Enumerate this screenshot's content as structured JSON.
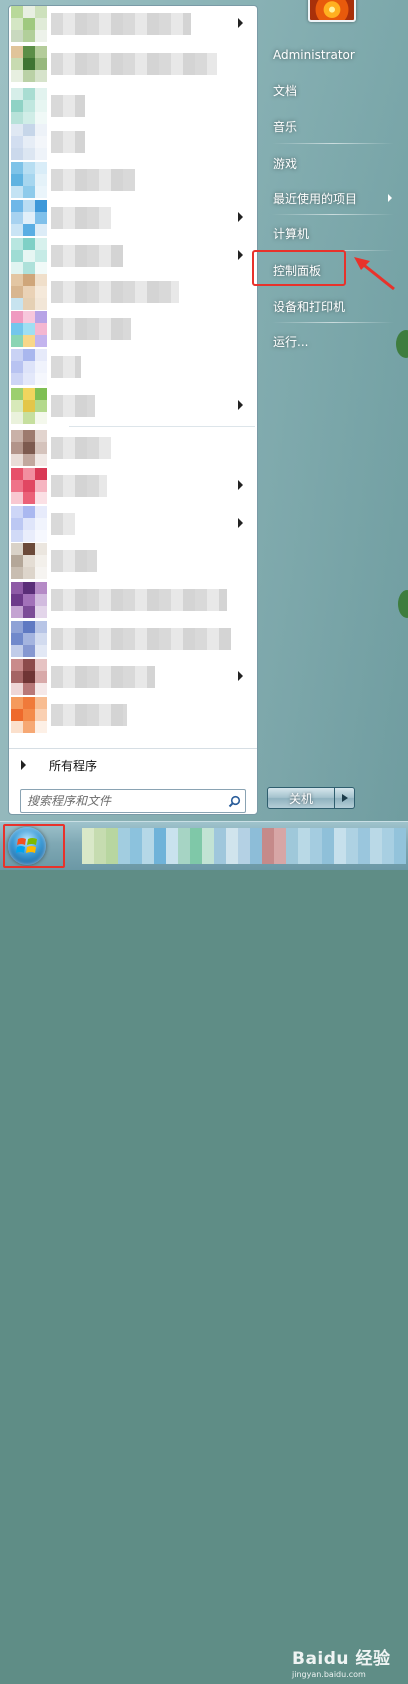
{
  "start_menu": {
    "all_programs_label": "所有程序",
    "search_placeholder": "搜索程序和文件",
    "right_items": [
      {
        "label": "Administrator",
        "has_submenu": false
      },
      {
        "label": "文档",
        "has_submenu": false
      },
      {
        "label": "音乐",
        "has_submenu": false
      },
      {
        "label": "游戏",
        "has_submenu": false
      },
      {
        "label": "最近使用的项目",
        "has_submenu": true
      },
      {
        "label": "计算机",
        "has_submenu": false
      },
      {
        "label": "控制面板",
        "has_submenu": false,
        "highlighted": true
      },
      {
        "label": "设备和打印机",
        "has_submenu": false
      },
      {
        "label": "运行...",
        "has_submenu": false
      }
    ],
    "shutdown_label": "关机"
  },
  "watermark": {
    "brand": "Baidu 经验",
    "url": "jingyan.baidu.com"
  },
  "colors": {
    "annotation_red": "#e8322b",
    "menu_text": "#ffffff"
  },
  "icons": [
    "arrow-right-icon",
    "search-icon",
    "start-orb-icon",
    "user-picture-icon",
    "pointer-arrow-icon"
  ]
}
